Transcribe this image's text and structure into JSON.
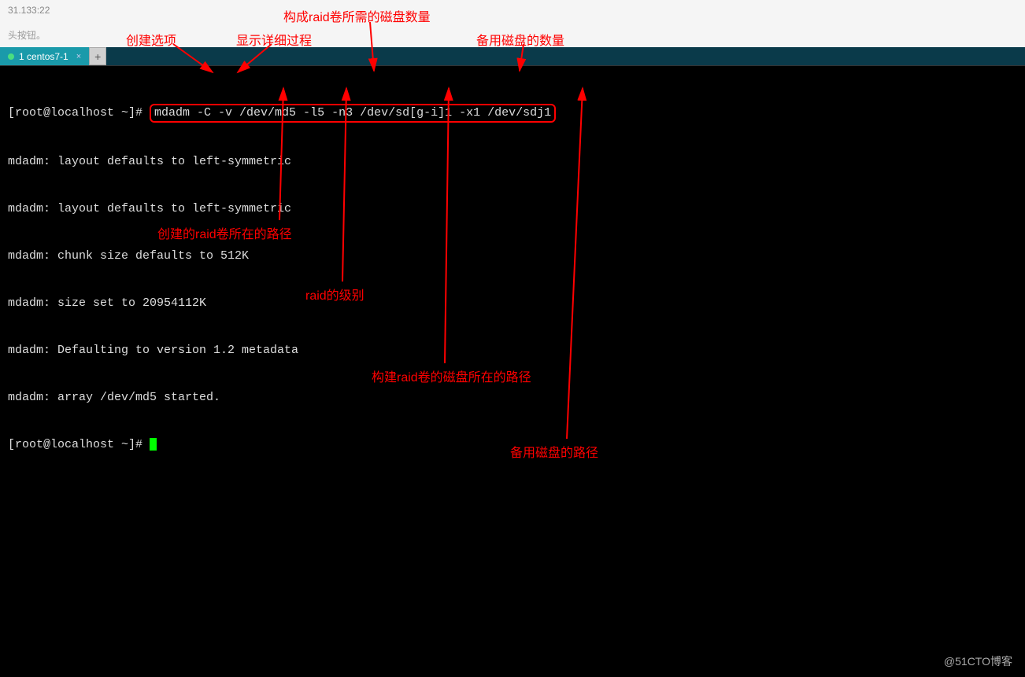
{
  "titlebar": {
    "text": "31.133:22"
  },
  "hint": {
    "text": "头按钮。"
  },
  "tab": {
    "label": "1 centos7-1"
  },
  "terminal": {
    "prompt": "[root@localhost ~]# ",
    "command": "mdadm -C -v /dev/md5 -l5 -n3 /dev/sd[g-i]1 -x1 /dev/sdj1",
    "lines": [
      "mdadm: layout defaults to left-symmetric",
      "mdadm: layout defaults to left-symmetric",
      "mdadm: chunk size defaults to 512K",
      "mdadm: size set to 20954112K",
      "mdadm: Defaulting to version 1.2 metadata",
      "mdadm: array /dev/md5 started."
    ],
    "prompt2": "[root@localhost ~]# "
  },
  "annotations": {
    "create_option": "创建选项",
    "verbose": "显示详细过程",
    "disk_count": "构成raid卷所需的磁盘数量",
    "spare_count": "备用磁盘的数量",
    "raid_path": "创建的raid卷所在的路径",
    "raid_level": "raid的级别",
    "build_disk_path": "构建raid卷的磁盘所在的路径",
    "spare_path": "备用磁盘的路径"
  },
  "watermark": "@51CTO博客"
}
